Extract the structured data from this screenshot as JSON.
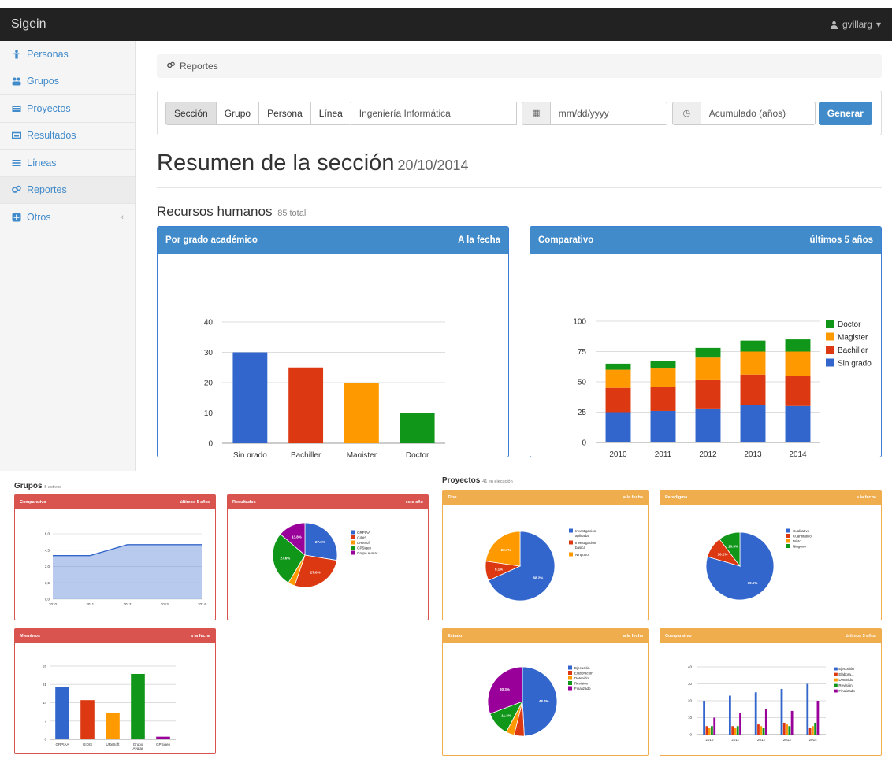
{
  "app": {
    "brand": "Sigein",
    "user": "gvillarg"
  },
  "sidebar": {
    "items": [
      {
        "label": "Personas",
        "icon": "person-icon"
      },
      {
        "label": "Grupos",
        "icon": "group-icon"
      },
      {
        "label": "Proyectos",
        "icon": "folder-icon"
      },
      {
        "label": "Resultados",
        "icon": "results-icon"
      },
      {
        "label": "Líneas",
        "icon": "lines-icon"
      },
      {
        "label": "Reportes",
        "icon": "reports-icon"
      },
      {
        "label": "Otros",
        "icon": "plus-icon",
        "chevron": "‹"
      }
    ]
  },
  "breadcrumb": {
    "label": "Reportes"
  },
  "filters": {
    "buttons": [
      "Sección",
      "Grupo",
      "Persona",
      "Línea"
    ],
    "selected": "Sección",
    "line_value": "Ingeniería Informática",
    "date_placeholder": "mm/dd/yyyy",
    "mode_value": "Acumulado (años)",
    "generate_label": "Generar"
  },
  "page": {
    "title": "Resumen de la sección",
    "date": "20/10/2014"
  },
  "rrhh": {
    "title": "Recursos humanos",
    "total": "85 total"
  },
  "colors": {
    "blue": "#3366cc",
    "red": "#dc3912",
    "orange": "#ff9900",
    "green": "#109618",
    "purple": "#990099"
  },
  "panels": {
    "grado": {
      "title": "Por grado académico",
      "meta": "A la fecha"
    },
    "comparativo": {
      "title": "Comparativo",
      "meta": "últimos 5 años"
    },
    "grupos_comp": {
      "title": "Comparativo",
      "meta": "últimos 5 años"
    },
    "resultados": {
      "title": "Resultados",
      "meta": "este año"
    },
    "miembros": {
      "title": "Miembros",
      "meta": "a la fecha"
    },
    "tipo": {
      "title": "Tipo",
      "meta": "a la fecha"
    },
    "paradigma": {
      "title": "Paradigma",
      "meta": "a la fecha"
    },
    "estado": {
      "title": "Estado",
      "meta": "a la fecha"
    },
    "proy_comp": {
      "title": "Comparativo",
      "meta": "últimos 5 años"
    }
  },
  "grupos": {
    "title": "Grupos",
    "sub": "5 activos"
  },
  "proyectos": {
    "title": "Proyectos",
    "sub": "41 en ejecución"
  },
  "chart_data": [
    {
      "id": "grado",
      "type": "bar",
      "categories": [
        "Sin grado",
        "Bachiller",
        "Magister",
        "Doctor"
      ],
      "values": [
        30,
        25,
        20,
        10
      ],
      "ylim": [
        0,
        40
      ],
      "yticks": [
        0,
        10,
        20,
        30,
        40
      ],
      "colors": [
        "#3366cc",
        "#dc3912",
        "#ff9900",
        "#109618"
      ]
    },
    {
      "id": "comparativo",
      "type": "bar",
      "stacked": true,
      "categories": [
        "2010",
        "2011",
        "2012",
        "2013",
        "2014"
      ],
      "series": [
        {
          "name": "Sin grado",
          "values": [
            25,
            26,
            28,
            31,
            30
          ],
          "color": "#3366cc"
        },
        {
          "name": "Bachiller",
          "values": [
            20,
            20,
            24,
            25,
            25
          ],
          "color": "#dc3912"
        },
        {
          "name": "Magister",
          "values": [
            15,
            15,
            18,
            19,
            20
          ],
          "color": "#ff9900"
        },
        {
          "name": "Doctor",
          "values": [
            5,
            6,
            8,
            9,
            10
          ],
          "color": "#109618"
        }
      ],
      "ylim": [
        0,
        100
      ],
      "yticks": [
        0,
        25,
        50,
        75,
        100
      ],
      "legend": "right"
    },
    {
      "id": "grupos_comp",
      "type": "area",
      "categories": [
        "2010",
        "2011",
        "2012",
        "2013",
        "2014"
      ],
      "values": [
        4,
        4,
        5,
        5,
        5
      ],
      "ylim": [
        0,
        6
      ],
      "yticks": [
        "0,0",
        "1,5",
        "3,0",
        "4,5",
        "6,0"
      ]
    },
    {
      "id": "resultados",
      "type": "pie",
      "slices": [
        {
          "name": "GRPIAA",
          "value": 27.6,
          "label": "27.6%",
          "color": "#3366cc"
        },
        {
          "name": "GIDIS",
          "value": 27.6,
          "label": "27.6%",
          "color": "#dc3912"
        },
        {
          "name": "UReSoft",
          "value": 3.4,
          "label": "",
          "color": "#ff9900"
        },
        {
          "name": "GPSigen",
          "value": 27.6,
          "label": "27.6%",
          "color": "#109618"
        },
        {
          "name": "Grupo Avatar",
          "value": 13.8,
          "label": "13.8%",
          "color": "#990099"
        }
      ],
      "legend": "right"
    },
    {
      "id": "miembros",
      "type": "bar",
      "categories": [
        "GRPIAA",
        "GIDIS",
        "UReSoft",
        "Grupo Avatar",
        "GPSigen"
      ],
      "values": [
        20,
        15,
        10,
        25,
        1
      ],
      "ylim": [
        0,
        28
      ],
      "yticks": [
        0,
        7,
        14,
        21,
        28
      ],
      "colors": [
        "#3366cc",
        "#dc3912",
        "#ff9900",
        "#109618",
        "#990099"
      ]
    },
    {
      "id": "tipo",
      "type": "pie",
      "slices": [
        {
          "name": "Investigación aplicada",
          "value": 68.2,
          "label": "68.2%",
          "color": "#3366cc"
        },
        {
          "name": "Investigación básica",
          "value": 9.1,
          "label": "9.1%",
          "color": "#dc3912"
        },
        {
          "name": "Ninguno",
          "value": 22.7,
          "label": "22.7%",
          "color": "#ff9900"
        }
      ],
      "legend": "right"
    },
    {
      "id": "paradigma",
      "type": "pie",
      "slices": [
        {
          "name": "Cualitativo",
          "value": 79.5,
          "label": "79.5%",
          "color": "#3366cc"
        },
        {
          "name": "Cuantitativo",
          "value": 10.2,
          "label": "10.2%",
          "color": "#dc3912"
        },
        {
          "name": "Mixto",
          "value": 0,
          "label": "",
          "color": "#ff9900"
        },
        {
          "name": "Ninguno",
          "value": 10.3,
          "label": "10.3%",
          "color": "#109618"
        }
      ],
      "legend": "right"
    },
    {
      "id": "estado",
      "type": "pie",
      "slices": [
        {
          "name": "Ejecución",
          "value": 48.4,
          "label": "48.4%",
          "color": "#3366cc"
        },
        {
          "name": "Elaboración",
          "value": 4.7,
          "label": "",
          "color": "#dc3912"
        },
        {
          "name": "Detenido",
          "value": 3.8,
          "label": "",
          "color": "#ff9900"
        },
        {
          "name": "Revisión",
          "value": 11.3,
          "label": "11.3%",
          "color": "#109618"
        },
        {
          "name": "Finalizado",
          "value": 30.3,
          "label": "30.3%",
          "color": "#990099"
        }
      ],
      "legend": "right"
    },
    {
      "id": "proy_comp",
      "type": "bar",
      "categories": [
        "2010",
        "2011",
        "2012",
        "2013",
        "2014"
      ],
      "series": [
        {
          "name": "Ejecución",
          "values": [
            20,
            23,
            25,
            27,
            30
          ],
          "color": "#3366cc"
        },
        {
          "name": "Elabora...",
          "values": [
            5,
            5,
            6,
            7,
            4
          ],
          "color": "#dc3912"
        },
        {
          "name": "Detenido",
          "values": [
            4,
            4,
            5,
            6,
            5
          ],
          "color": "#ff9900"
        },
        {
          "name": "Revisión",
          "values": [
            5,
            5,
            4,
            5,
            7
          ],
          "color": "#109618"
        },
        {
          "name": "Finalizado",
          "values": [
            10,
            13,
            15,
            14,
            20
          ],
          "color": "#990099"
        }
      ],
      "ylim": [
        0,
        40
      ],
      "yticks": [
        0,
        10,
        20,
        30,
        40
      ],
      "legend": "right"
    }
  ]
}
